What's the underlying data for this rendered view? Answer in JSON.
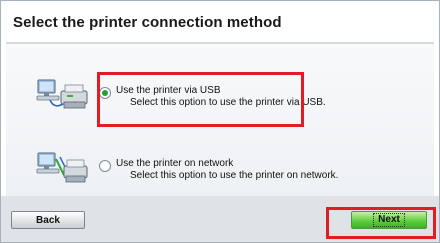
{
  "title": "Select the printer connection method",
  "options": [
    {
      "icon": "usb-connection-icon",
      "label": "Use the printer via USB",
      "description": "Select this option to use the printer via USB.",
      "selected": true
    },
    {
      "icon": "network-connection-icon",
      "label": "Use the printer on network",
      "description": "Select this option to use the printer on network.",
      "selected": false
    }
  ],
  "buttons": {
    "back": "Back",
    "next": "Next"
  },
  "colors": {
    "highlight": "#e01d24",
    "next_button": "#5fcf3f",
    "radio_selected": "#1aa52e"
  }
}
